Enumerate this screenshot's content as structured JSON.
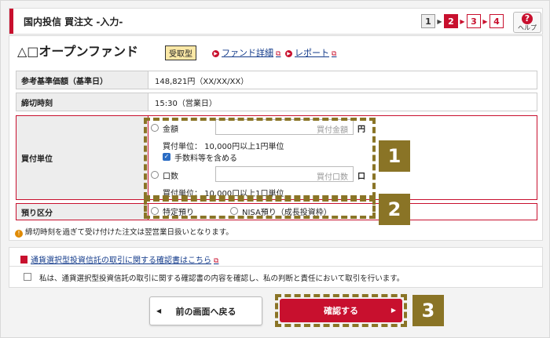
{
  "header": {
    "title": "国内投信 買注文 -入力-",
    "steps": [
      "1",
      "2",
      "3",
      "4"
    ],
    "help_label": "ヘルプ",
    "help_symbol": "?"
  },
  "fund": {
    "name": "△□オープンファンド",
    "badge": "受取型",
    "links": [
      {
        "label": "ファンド詳細"
      },
      {
        "label": "レポート"
      }
    ]
  },
  "info_rows": [
    {
      "label": "参考基準価額（基準日）",
      "value": "148,821円（XX/XX/XX）"
    },
    {
      "label": "締切時刻",
      "value": "15:30（営業日）"
    }
  ],
  "purchase_unit": {
    "label": "買付単位",
    "amount_option": "金額",
    "amount_placeholder": "買付金額",
    "amount_unit": "円",
    "amount_note": "買付単位： 10,000円以上1円単位",
    "include_fees": "手数料等を含める",
    "units_option": "口数",
    "units_placeholder": "買付口数",
    "units_unit": "口",
    "units_note": "買付単位： 10,000口以上1口単位"
  },
  "deposit": {
    "label": "預り区分",
    "options": [
      "特定預り",
      "NISA預り（成長投資枠）"
    ]
  },
  "note": "締切時刻を過ぎて受け付けた注文は翌営業日扱いとなります。",
  "confirmation": {
    "link": "通貨選択型投資信託の取引に関する確認書はこちら",
    "checkbox_text": "私は、通貨選択型投資信託の取引に関する確認書の内容を確認し、私の判断と責任において取引を行います。"
  },
  "buttons": {
    "back": "前の画面へ戻る",
    "confirm": "確認する"
  },
  "callouts": [
    "1",
    "2",
    "3"
  ],
  "colors": {
    "accent": "#c8102e",
    "callout": "#8a7426"
  }
}
